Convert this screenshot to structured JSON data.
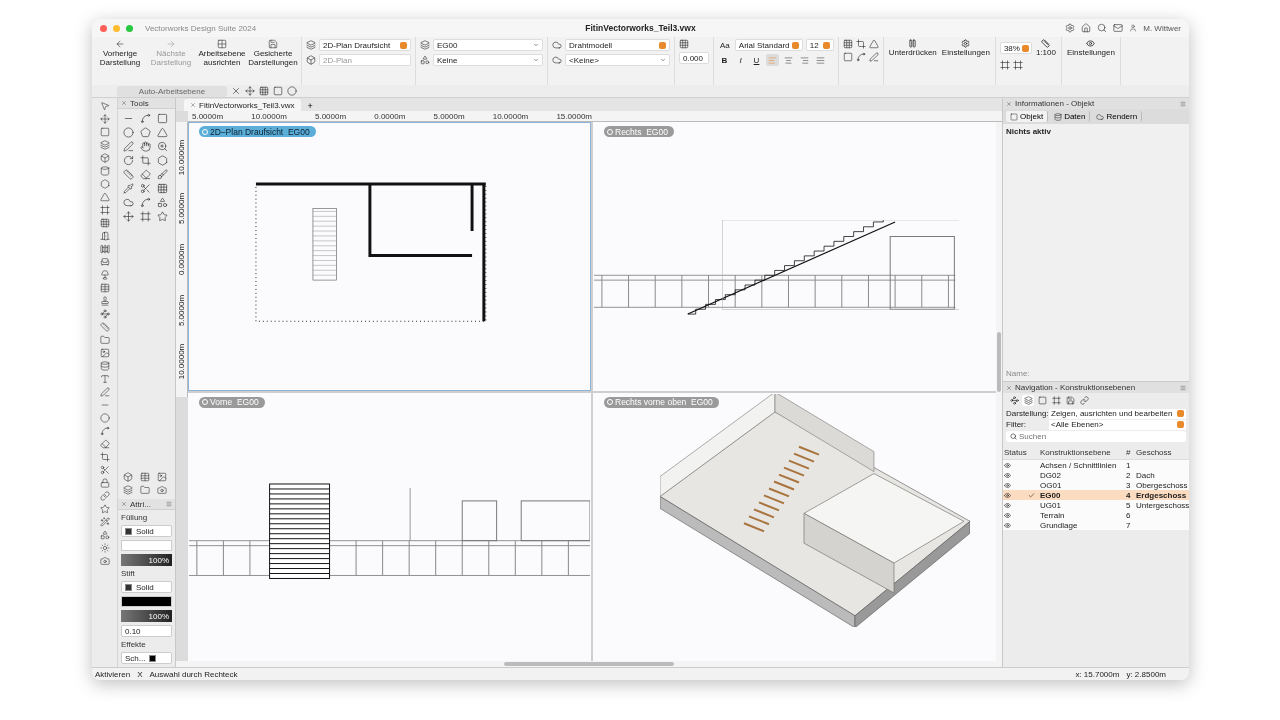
{
  "window": {
    "app_title": "Vectorworks Design Suite 2024",
    "document_title": "FitinVectorworks_Teil3.vwx",
    "user": "M. Wittwer"
  },
  "toolbar": {
    "view_buttons": [
      {
        "label": "Vorherige Darstellung",
        "disabled": false
      },
      {
        "label": "Nächste Darstellung",
        "disabled": true
      },
      {
        "label": "Arbeitsebene ausrichten",
        "disabled": false
      },
      {
        "label": "Gesicherte Darstellungen",
        "disabled": false
      }
    ],
    "view_select": {
      "value": "2D-Plan Draufsicht",
      "disabled": false
    },
    "projection_select": {
      "value": "2D-Plan",
      "disabled": true
    },
    "layer_select": "EG00",
    "class_select": "Keine",
    "render_select": "Drahtmodell",
    "render_style_select": "<Keine>",
    "elevation": "0.000",
    "font_icon": "Aa",
    "font_select": "Arial Standard",
    "font_size": "12",
    "text_styles": [
      "B",
      "I",
      "U"
    ],
    "alignments": [
      {
        "selected": true
      },
      {
        "selected": false
      },
      {
        "selected": false
      },
      {
        "selected": false
      }
    ],
    "suppress_button": "Unterdrücken",
    "settings_button": "Einstellungen",
    "zoom": "38%",
    "scale": "1:100",
    "view_settings_button": "Einstellungen",
    "auto_plane": "Auto-Arbeitsebene"
  },
  "tools_palette": {
    "title": "Tools"
  },
  "attributes_palette": {
    "title": "Attri...",
    "fill_label": "Füllung",
    "fill_style": "Solid",
    "fill_opacity": "100%",
    "pen_label": "Stift",
    "pen_style": "Solid",
    "pen_opacity": "100%",
    "line_weight": "0.10",
    "effects_label": "Effekte",
    "shadow_label": "Sch..."
  },
  "document": {
    "tab": "FitinVectorworks_Teil3.vwx",
    "add_tab": "+",
    "ruler_x": [
      "5.0000m",
      "10.0000m",
      "5.0000m",
      "0.0000m",
      "5.0000m",
      "10.0000m",
      "15.0000m"
    ],
    "ruler_y": [
      "10.0000m",
      "5.0000m",
      "0.0000m",
      "5.0000m",
      "10.0000m"
    ],
    "viewports": [
      {
        "label": "2D–Plan Draufsicht  EG00",
        "kind": "plan",
        "selected": true
      },
      {
        "label": "Rechts  EG00",
        "kind": "right",
        "selected": false
      },
      {
        "label": "Vorne  EG00",
        "kind": "front",
        "selected": false
      },
      {
        "label": "Rechts vorne oben  EG00",
        "kind": "iso",
        "selected": false
      }
    ]
  },
  "info_panel": {
    "title": "Informationen - Objekt",
    "tabs": [
      {
        "label": "Objekt",
        "selected": true
      },
      {
        "label": "Daten",
        "selected": false
      },
      {
        "label": "Rendern",
        "selected": false
      }
    ],
    "status": "Nichts aktiv",
    "name_label": "Name:"
  },
  "navigation_panel": {
    "title": "Navigation - Konstruktionsebenen",
    "view_tabs": [
      {
        "selected": false
      },
      {
        "selected": true
      },
      {
        "selected": false
      },
      {
        "selected": false
      },
      {
        "selected": false
      },
      {
        "selected": false
      }
    ],
    "display_label": "Darstellung:",
    "display_value": "Zeigen, ausrichten und bearbeiten",
    "filter_label": "Filter:",
    "filter_value": "<Alle Ebenen>",
    "search_placeholder": "Suchen",
    "columns": [
      "Status",
      "Konstruktionsebene",
      "#",
      "Geschoss"
    ],
    "rows": [
      {
        "name": "Achsen / Schnittlinien",
        "number": "1",
        "story": "",
        "selected": false
      },
      {
        "name": "DG02",
        "number": "2",
        "story": "Dach",
        "selected": false
      },
      {
        "name": "OG01",
        "number": "3",
        "story": "Obergeschoss",
        "selected": false
      },
      {
        "name": "EG00",
        "number": "4",
        "story": "Erdgeschoss",
        "selected": true
      },
      {
        "name": "UG01",
        "number": "5",
        "story": "Untergeschoss",
        "selected": false
      },
      {
        "name": "Terrain",
        "number": "6",
        "story": "",
        "selected": false
      },
      {
        "name": "Grundlage",
        "number": "7",
        "story": "",
        "selected": false
      }
    ]
  },
  "status_bar": {
    "tool": "Aktivieren",
    "separator": "X",
    "mode": "Auswahl durch Rechteck",
    "x": "x: 15.7000m",
    "y": "y: 2.8500m"
  }
}
